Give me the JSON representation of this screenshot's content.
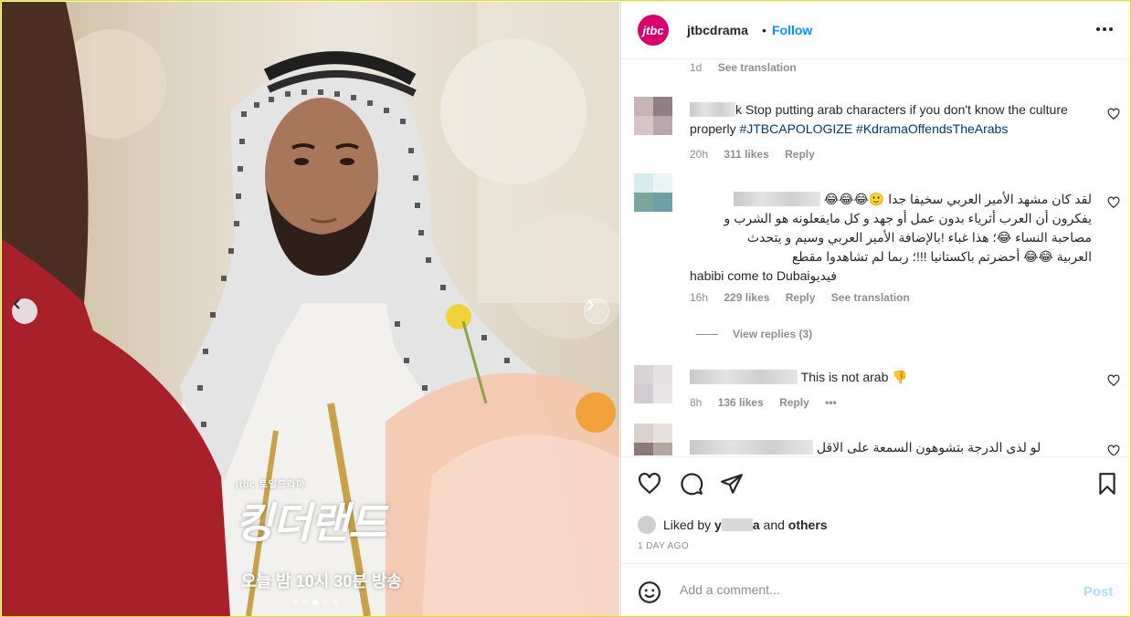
{
  "header": {
    "logo_text": "jtbc",
    "username": "jtbcdrama",
    "separator": "•",
    "follow_label": "Follow"
  },
  "comments": [
    {
      "id": "top",
      "time": "1d",
      "see_translation": "See translation"
    },
    {
      "id": "c1",
      "name_fragment": "k",
      "text_plain": "Stop putting arab characters if you don't know the culture properly ",
      "hashtags": "#JTBCAPOLOGIZE #KdramaOffendsTheArabs",
      "time": "20h",
      "likes": "311 likes",
      "reply": "Reply"
    },
    {
      "id": "c2",
      "line1": "لقد كان مشهد الأمير العربي سخيفا جدا 🙂😂😂😂",
      "line2": "يفكرون أن العرب أثرياء بدون عمل أو جهد و كل مايفعلونه هو الشرب و",
      "line3": "مصاحبة النساء 😂؛ هذا غباء !بالإضافة الأمير العربي وسيم و يتحدث",
      "line4": "العربية 😂😂 أحضرتم باكستانيا !!!؛ ربما لم تشاهدوا مقطع",
      "line5": "habibi come to Dubaiفيديو",
      "time": "16h",
      "likes": "229 likes",
      "reply": "Reply",
      "see_translation": "See translation",
      "view_replies": "View replies (3)"
    },
    {
      "id": "c3",
      "text": "This is not arab 👎",
      "time": "8h",
      "likes": "136 likes",
      "reply": "Reply",
      "more": "•••"
    },
    {
      "id": "c4",
      "text": "لو لذى الدرجة بتشوهون السمعة على الاقل"
    }
  ],
  "liked_by": {
    "prefix": "Liked by",
    "name_visible": "y",
    "name_end": "a",
    "and": "and",
    "others": "others"
  },
  "date": "1 DAY AGO",
  "add_comment": {
    "placeholder": "Add a comment...",
    "post_label": "Post"
  },
  "poster": {
    "brand": "jtbc 토일드라마",
    "title": "킹더랜드",
    "subtitle": "오늘 밤 10시 30분 방송"
  },
  "carousel": {
    "total_slides": 5,
    "active_slide": 4
  },
  "colors": {
    "follow": "#0095f6",
    "hashtag": "#00376b",
    "post_disabled": "#b3dbff",
    "brand": "#d6006f"
  }
}
